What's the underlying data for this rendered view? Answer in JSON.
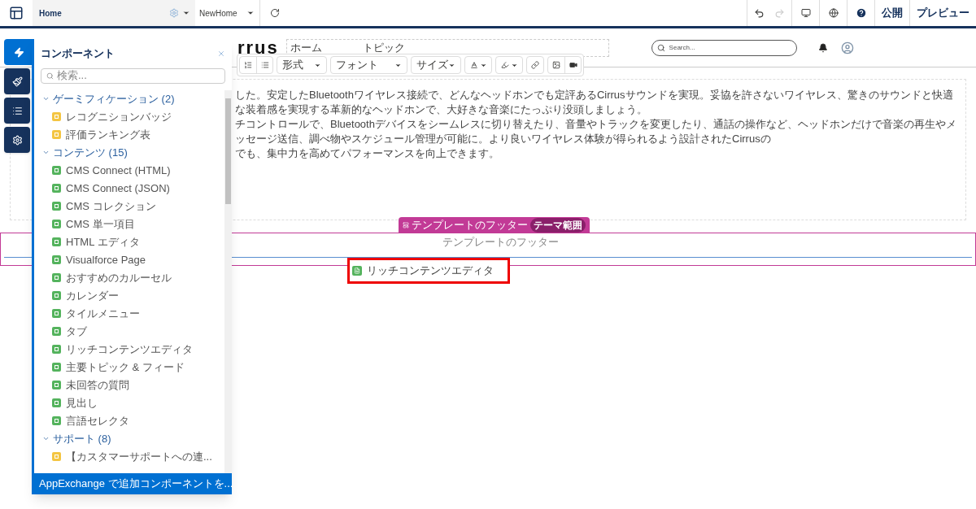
{
  "topbar": {
    "page": "Home",
    "page_variant": "NewHome",
    "publish": "公開",
    "preview": "プレビュー"
  },
  "site": {
    "logo": "rrus",
    "nav": [
      "ホーム",
      "トピック"
    ],
    "search_placeholder": "Search..."
  },
  "editor": {
    "toolbar": {
      "dropdowns": [
        "形式",
        "フォント",
        "サイズ"
      ]
    },
    "paragraphs": [
      "した。安定したBluetoothワイヤレス接続で、どんなヘッドホンでも定評あるCirrusサウンドを実現。妥協を許さないワイヤレス、驚きのサウンドと快適な装着感を実現する革新的なヘッドホンで、大好きな音楽にたっぷり没頭しましょう。",
      "チコントロールで、Bluetoothデバイスをシームレスに切り替えたり、音量やトラックを変更したり、通話の操作など、ヘッドホンだけで音楽の再生やメッセージ送信、調べ物やスケジュール管理が可能に。より良いワイヤレス体験が得られるよう設計されたCirrusの",
      "でも、集中力を高めてパフォーマンスを向上できます。"
    ]
  },
  "footer": {
    "tab_label": "テンプレートのフッター",
    "tab_badge": "テーマ範囲",
    "placeholder": "テンプレートのフッター",
    "dragged_item": "リッチコンテンツエディタ"
  },
  "side_tabs": [
    {
      "kind": "components",
      "selected": true
    },
    {
      "kind": "theme",
      "selected": false
    },
    {
      "kind": "navigator",
      "selected": false
    },
    {
      "kind": "settings",
      "selected": false
    }
  ],
  "panel": {
    "title": "コンポーネント",
    "search_placeholder": "検索...",
    "footer_link": "AppExchange で追加コンポーネントを...",
    "groups": [
      {
        "label": "ゲーミフィケーション (2)",
        "expanded": true,
        "items": [
          {
            "label": "レコグニションバッジ",
            "color": "#f4c542"
          },
          {
            "label": "評価ランキング表",
            "color": "#f4c542"
          }
        ]
      },
      {
        "label": "コンテンツ (15)",
        "expanded": true,
        "items": [
          {
            "label": "CMS Connect (HTML)",
            "color": "#54b35d"
          },
          {
            "label": "CMS Connect (JSON)",
            "color": "#54b35d"
          },
          {
            "label": "CMS コレクション",
            "color": "#54b35d"
          },
          {
            "label": "CMS 単一項目",
            "color": "#54b35d"
          },
          {
            "label": "HTML エディタ",
            "color": "#54b35d"
          },
          {
            "label": "Visualforce Page",
            "color": "#54b35d"
          },
          {
            "label": "おすすめのカルーセル",
            "color": "#54b35d"
          },
          {
            "label": "カレンダー",
            "color": "#54b35d"
          },
          {
            "label": "タイルメニュー",
            "color": "#54b35d"
          },
          {
            "label": "タブ",
            "color": "#54b35d"
          },
          {
            "label": "リッチコンテンツエディタ",
            "color": "#54b35d"
          },
          {
            "label": "主要トピック & フィード",
            "color": "#54b35d"
          },
          {
            "label": "未回答の質問",
            "color": "#54b35d"
          },
          {
            "label": "見出し",
            "color": "#54b35d"
          },
          {
            "label": "言語セレクタ",
            "color": "#54b35d"
          }
        ]
      },
      {
        "label": "サポート (8)",
        "expanded": true,
        "items": [
          {
            "label": "【カスタマーサポートへの連...",
            "color": "#f4c542"
          }
        ]
      }
    ]
  }
}
